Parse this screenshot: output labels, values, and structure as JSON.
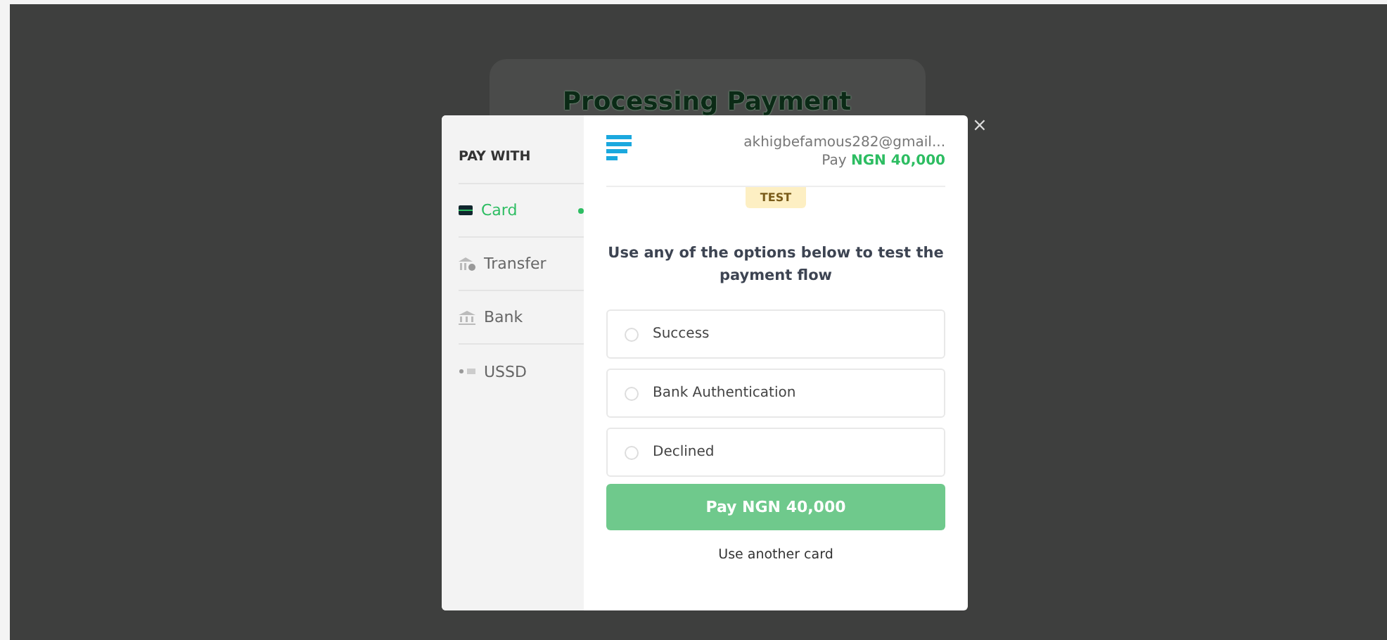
{
  "background_card": {
    "title": "Processing Payment"
  },
  "sidebar": {
    "heading": "PAY WITH",
    "items": [
      {
        "label": "Card",
        "kind": "card",
        "selected": true
      },
      {
        "label": "Transfer",
        "kind": "transfer",
        "selected": false
      },
      {
        "label": "Bank",
        "kind": "bank",
        "selected": false
      },
      {
        "label": "USSD",
        "kind": "ussd",
        "selected": false
      }
    ]
  },
  "header": {
    "email": "akhigbefamous282@gmail...",
    "pay_label": "Pay",
    "amount": "NGN 40,000"
  },
  "badge": "TEST",
  "instructions": "Use any of the options below to test the payment flow",
  "options": [
    {
      "label": "Success",
      "selected": false
    },
    {
      "label": "Bank Authentication",
      "selected": false
    },
    {
      "label": "Declined",
      "selected": false
    }
  ],
  "pay_button": "Pay NGN 40,000",
  "alt_link": "Use another card",
  "close": "×"
}
